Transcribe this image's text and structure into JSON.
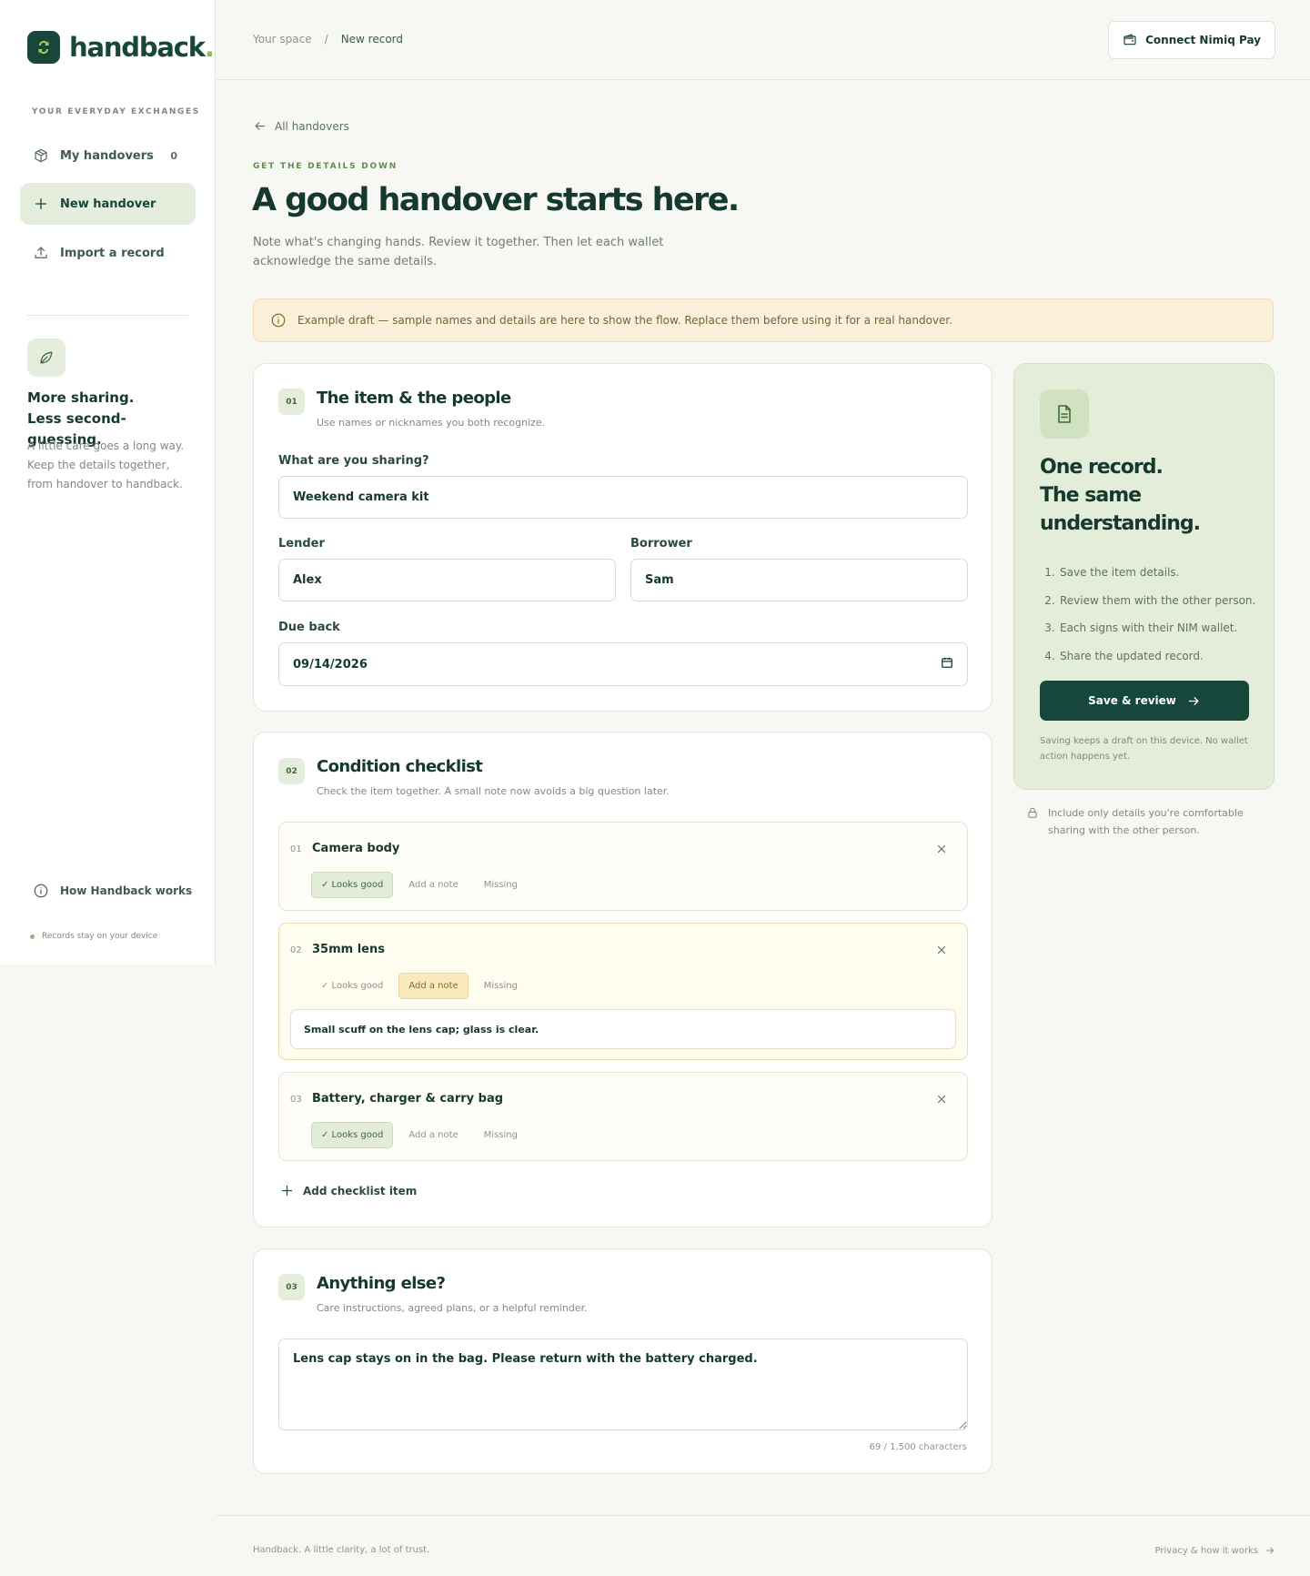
{
  "brand": {
    "name": "handback",
    "dot": "."
  },
  "sidebar": {
    "eyebrow": "YOUR EVERYDAY EXCHANGES",
    "items": [
      {
        "label": "My handovers",
        "count": "0",
        "icon": "box-icon"
      },
      {
        "label": "New handover",
        "icon": "plus-icon"
      },
      {
        "label": "Import a record",
        "icon": "upload-icon"
      }
    ],
    "promo": {
      "icon": "leaf-icon",
      "heading_line1": "More sharing.",
      "heading_line2": "Less second-guessing.",
      "copy": "A little care goes a long way. Keep the details together, from handover to handback."
    },
    "how_link": "How Handback works",
    "status": "Records stay on your device"
  },
  "topbar": {
    "breadcrumb": {
      "root": "Your space",
      "separator": "/",
      "current": "New record"
    },
    "connect_label": "Connect Nimiq Pay"
  },
  "header": {
    "back_label": "All handovers",
    "eyebrow": "GET THE DETAILS DOWN",
    "title": "A good handover starts here.",
    "subtitle": "Note what's changing hands. Review it together. Then let each wallet acknowledge the same details."
  },
  "banner": {
    "text": "Example draft — sample names and details are here to show the flow. Replace them before using it for a real handover."
  },
  "section1": {
    "step": "01",
    "title": "The item & the people",
    "subtitle": "Use names or nicknames you both recognize.",
    "item_label": "What are you sharing?",
    "item_value": "Weekend camera kit",
    "lender_label": "Lender",
    "lender_value": "Alex",
    "borrower_label": "Borrower",
    "borrower_value": "Sam",
    "due_label": "Due back",
    "due_value": "09/14/2026"
  },
  "section2": {
    "step": "02",
    "title": "Condition checklist",
    "subtitle": "Check the item together. A small note now avoids a big question later.",
    "options": {
      "good": "✓ Looks good",
      "note": "Add a note",
      "missing": "Missing"
    },
    "items": [
      {
        "num": "01",
        "name": "Camera body",
        "state": "good"
      },
      {
        "num": "02",
        "name": "35mm lens",
        "state": "note",
        "note": "Small scuff on the lens cap; glass is clear."
      },
      {
        "num": "03",
        "name": "Battery, charger & carry bag",
        "state": "good"
      }
    ],
    "add_label": "Add checklist item"
  },
  "section3": {
    "step": "03",
    "title": "Anything else?",
    "subtitle": "Care instructions, agreed plans, or a helpful reminder.",
    "notes_value": "Lens cap stays on in the bag. Please return with the battery charged.",
    "char_count": "69 / 1,500 characters"
  },
  "panel": {
    "icon": "document-icon",
    "title_line1": "One record.",
    "title_line2": "The same",
    "title_line3": "understanding.",
    "steps": [
      {
        "n": "1.",
        "text": "Save the item details."
      },
      {
        "n": "2.",
        "text": "Review them with the other person."
      },
      {
        "n": "3.",
        "text": "Each signs with their NIM wallet."
      },
      {
        "n": "4.",
        "text": "Share the updated record."
      }
    ],
    "save_label": "Save & review",
    "note": "Saving keeps a draft on this device. No wallet action happens yet.",
    "privacy": "Include only details you're comfortable sharing with the other person."
  },
  "footer": {
    "left": "Handback. A little clarity, a lot of trust.",
    "right": "Privacy & how it works"
  },
  "colors": {
    "brand": "#17463a",
    "accent": "#8cc152",
    "banner": "#fbf1db",
    "panel": "#e4edd9"
  }
}
